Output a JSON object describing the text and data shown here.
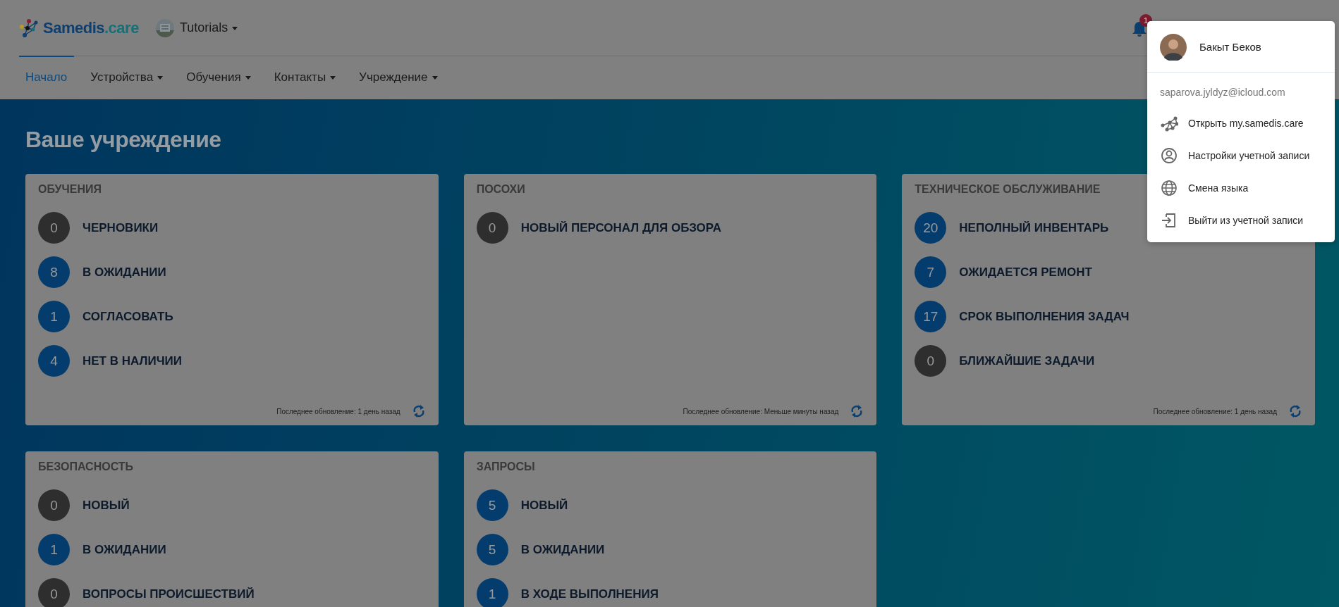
{
  "header": {
    "brand_name": "Samedis",
    "brand_suffix": ".care",
    "tenant": "Tutorials",
    "notification_count": "1"
  },
  "nav": [
    {
      "label": "Начало",
      "selected": true,
      "has_menu": false
    },
    {
      "label": "Устройства",
      "selected": false,
      "has_menu": true
    },
    {
      "label": "Обучения",
      "selected": false,
      "has_menu": true
    },
    {
      "label": "Контакты",
      "selected": false,
      "has_menu": true
    },
    {
      "label": "Учреждение",
      "selected": false,
      "has_menu": true
    }
  ],
  "page_title": "Ваше учреждение",
  "cards": [
    {
      "title": "ОБУЧЕНИЯ",
      "updated": "Последнее обновление: 1 день назад",
      "items": [
        {
          "count": "0",
          "label": "ЧЕРНОВИКИ",
          "kind": "empty"
        },
        {
          "count": "8",
          "label": "В ОЖИДАНИИ",
          "kind": "active"
        },
        {
          "count": "1",
          "label": "СОГЛАСОВАТЬ",
          "kind": "active"
        },
        {
          "count": "4",
          "label": "НЕТ В НАЛИЧИИ",
          "kind": "active"
        }
      ]
    },
    {
      "title": "ПОСОХИ",
      "updated": "Последнее обновление: Меньше минуты назад",
      "items": [
        {
          "count": "0",
          "label": "НОВЫЙ ПЕРСОНАЛ ДЛЯ ОБЗОРА",
          "kind": "empty"
        }
      ]
    },
    {
      "title": "ТЕХНИЧЕСКОЕ ОБСЛУЖИВАНИЕ",
      "updated": "Последнее обновление: 1 день назад",
      "items": [
        {
          "count": "20",
          "label": "НЕПОЛНЫЙ ИНВЕНТАРЬ",
          "kind": "active"
        },
        {
          "count": "7",
          "label": "ОЖИДАЕТСЯ РЕМОНТ",
          "kind": "active"
        },
        {
          "count": "17",
          "label": "СРОК ВЫПОЛНЕНИЯ ЗАДАЧ",
          "kind": "active"
        },
        {
          "count": "0",
          "label": "БЛИЖАЙШИЕ ЗАДАЧИ",
          "kind": "empty"
        }
      ]
    },
    {
      "title": "БЕЗОПАСНОСТЬ",
      "items": [
        {
          "count": "0",
          "label": "НОВЫЙ",
          "kind": "empty"
        },
        {
          "count": "1",
          "label": "В ОЖИДАНИИ",
          "kind": "active"
        },
        {
          "count": "0",
          "label": "ВОПРОСЫ ПРОИСШЕСТВИЙ",
          "kind": "empty"
        }
      ]
    },
    {
      "title": "ЗАПРОСЫ",
      "items": [
        {
          "count": "5",
          "label": "НОВЫЙ",
          "kind": "active"
        },
        {
          "count": "5",
          "label": "В ОЖИДАНИИ",
          "kind": "active"
        },
        {
          "count": "1",
          "label": "В ХОДЕ ВЫПОЛНЕНИЯ",
          "kind": "active"
        }
      ]
    }
  ],
  "user_menu": {
    "name": "Бакыт Беков",
    "email": "saparova.jyldyz@icloud.com",
    "items": [
      {
        "label": "Открыть my.samedis.care",
        "kind": "network"
      },
      {
        "label": "Настройки учетной записи",
        "kind": "account"
      },
      {
        "label": "Смена языка",
        "kind": "globe"
      },
      {
        "label": "Выйти из учетной записи",
        "kind": "logout"
      }
    ]
  }
}
